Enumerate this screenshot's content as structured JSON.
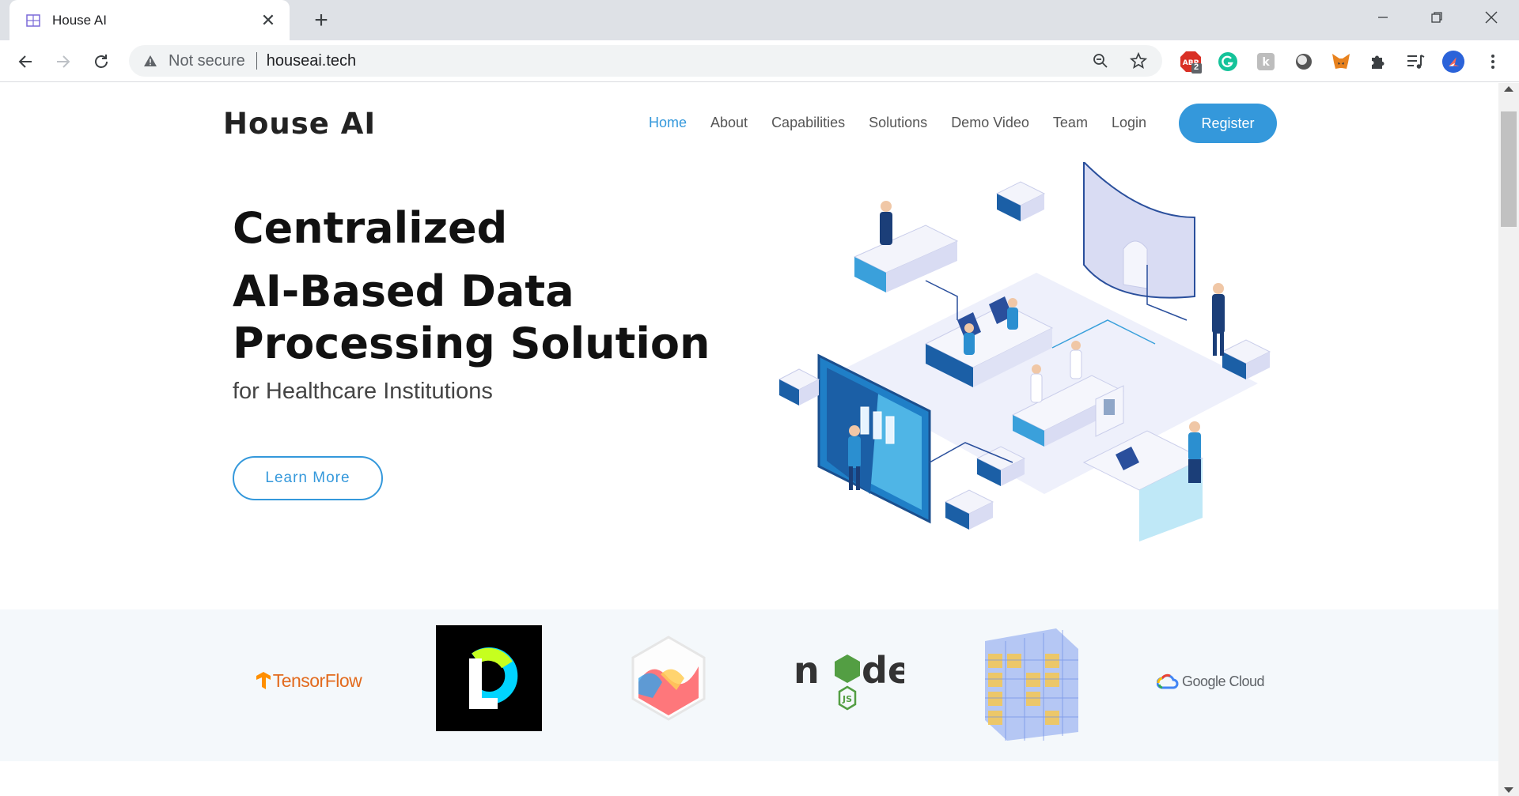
{
  "browser": {
    "tab_title": "House AI",
    "new_tab_icon": "plus-icon",
    "omnibox": {
      "security_label": "Not secure",
      "url": "houseai.tech"
    },
    "extensions": {
      "adblock_badge": "2"
    },
    "accent": "#1a73e8"
  },
  "site": {
    "logo": "House AI",
    "nav": [
      "Home",
      "About",
      "Capabilities",
      "Solutions",
      "Demo Video",
      "Team",
      "Login"
    ],
    "active_nav": "Home",
    "register_label": "Register",
    "accent_color": "#3498db"
  },
  "hero": {
    "line1": "Centralized",
    "line2": "AI-Based Data",
    "line3": "Processing Solution",
    "subtitle": "for Healthcare Institutions",
    "cta_label": "Learn More"
  },
  "clients": {
    "tensorflow": "TensorFlow",
    "node_js": "JS",
    "google_cloud": "Google Cloud"
  }
}
